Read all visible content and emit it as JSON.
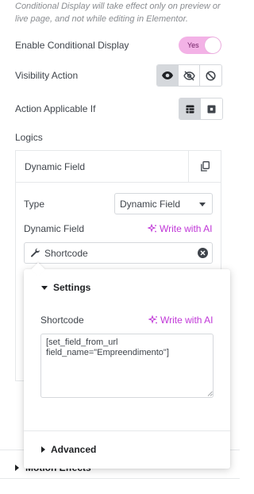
{
  "notice": "Conditional Display will take effect only on preview or live page, and not while editing in Elementor.",
  "enable_conditional_display": {
    "label": "Enable Conditional Display",
    "toggle_text": "Yes",
    "on": true
  },
  "visibility_action": {
    "label": "Visibility Action",
    "options": [
      "eye-icon",
      "eye-slash-icon",
      "ban-icon"
    ],
    "active_index": 0
  },
  "action_applicable_if": {
    "label": "Action Applicable If",
    "options": [
      "all-conditions-icon",
      "any-condition-icon"
    ],
    "active_index": 0
  },
  "logics": {
    "label": "Logics",
    "item_title": "Dynamic Field",
    "type_label": "Type",
    "type_value": "Dynamic Field",
    "dynamic_field_label": "Dynamic Field",
    "write_with_ai": "Write with AI",
    "dynamic_field_value": "Shortcode"
  },
  "popover": {
    "settings_title": "Settings",
    "shortcode_label": "Shortcode",
    "write_with_ai": "Write with AI",
    "shortcode_value": "[set_field_from_url\nfield_name=\"Empreendimento\"]",
    "advanced_title": "Advanced"
  },
  "motion_effects": "Motion Effects",
  "colors": {
    "accent": "#c036d7",
    "toggle_bg": "#f3b2e6",
    "text": "#3f444b"
  }
}
